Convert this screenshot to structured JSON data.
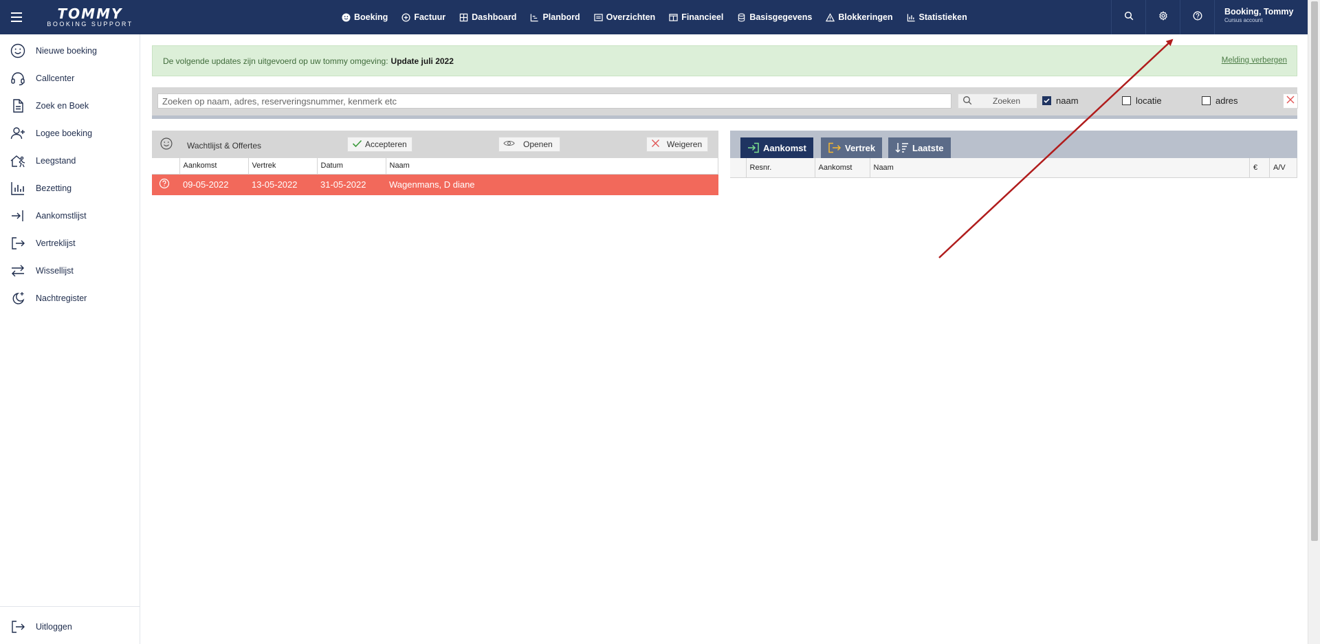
{
  "header": {
    "logo_top": "TOMMY",
    "logo_sub": "BOOKING SUPPORT",
    "nav": [
      {
        "label": "Boeking",
        "icon": "smiley-icon"
      },
      {
        "label": "Factuur",
        "icon": "plus-circle-icon"
      },
      {
        "label": "Dashboard",
        "icon": "grid-icon"
      },
      {
        "label": "Planbord",
        "icon": "chart-line-icon"
      },
      {
        "label": "Overzichten",
        "icon": "list-window-icon"
      },
      {
        "label": "Financieel",
        "icon": "columns-icon"
      },
      {
        "label": "Basisgegevens",
        "icon": "database-icon"
      },
      {
        "label": "Blokkeringen",
        "icon": "warning-icon"
      },
      {
        "label": "Statistieken",
        "icon": "bar-chart-icon"
      }
    ],
    "user_name": "Booking, Tommy",
    "user_sub": "Cursus account"
  },
  "sidebar": {
    "items": [
      {
        "label": "Nieuwe boeking"
      },
      {
        "label": "Callcenter"
      },
      {
        "label": "Zoek en Boek"
      },
      {
        "label": "Logee boeking"
      },
      {
        "label": "Leegstand"
      },
      {
        "label": "Bezetting"
      },
      {
        "label": "Aankomstlijst"
      },
      {
        "label": "Vertreklijst"
      },
      {
        "label": "Wissellijst"
      },
      {
        "label": "Nachtregister"
      }
    ],
    "logout": "Uitloggen"
  },
  "notice": {
    "text": "De volgende updates zijn uitgevoerd op uw tommy omgeving:",
    "highlight": "Update juli 2022",
    "hide": "Melding verbergen"
  },
  "search": {
    "placeholder": "Zoeken op naam, adres, reserveringsnummer, kenmerk etc",
    "button": "Zoeken",
    "options": [
      {
        "label": "naam",
        "checked": true
      },
      {
        "label": "locatie",
        "checked": false
      },
      {
        "label": "adres",
        "checked": false
      }
    ]
  },
  "waitlist": {
    "title": "Wachtlijst & Offertes",
    "accept": "Accepteren",
    "open": "Openen",
    "reject": "Weigeren",
    "columns": [
      "Aankomst",
      "Vertrek",
      "Datum",
      "Naam"
    ],
    "rows": [
      {
        "aankomst": "09-05-2022",
        "vertrek": "13-05-2022",
        "datum": "31-05-2022",
        "naam": "Wagenmans, D diane",
        "color": "#f2695b"
      }
    ]
  },
  "arrivals": {
    "tabs": [
      {
        "label": "Aankomst",
        "active": true
      },
      {
        "label": "Vertrek",
        "active": false
      },
      {
        "label": "Laatste",
        "active": false
      }
    ],
    "columns": [
      "Resnr.",
      "Aankomst",
      "Naam",
      "€",
      "A/V"
    ]
  },
  "colors": {
    "brand": "#1f3461",
    "notice_bg": "#dcefd8",
    "row_alert": "#f2695b",
    "annotation_arrow": "#b01c1c"
  }
}
